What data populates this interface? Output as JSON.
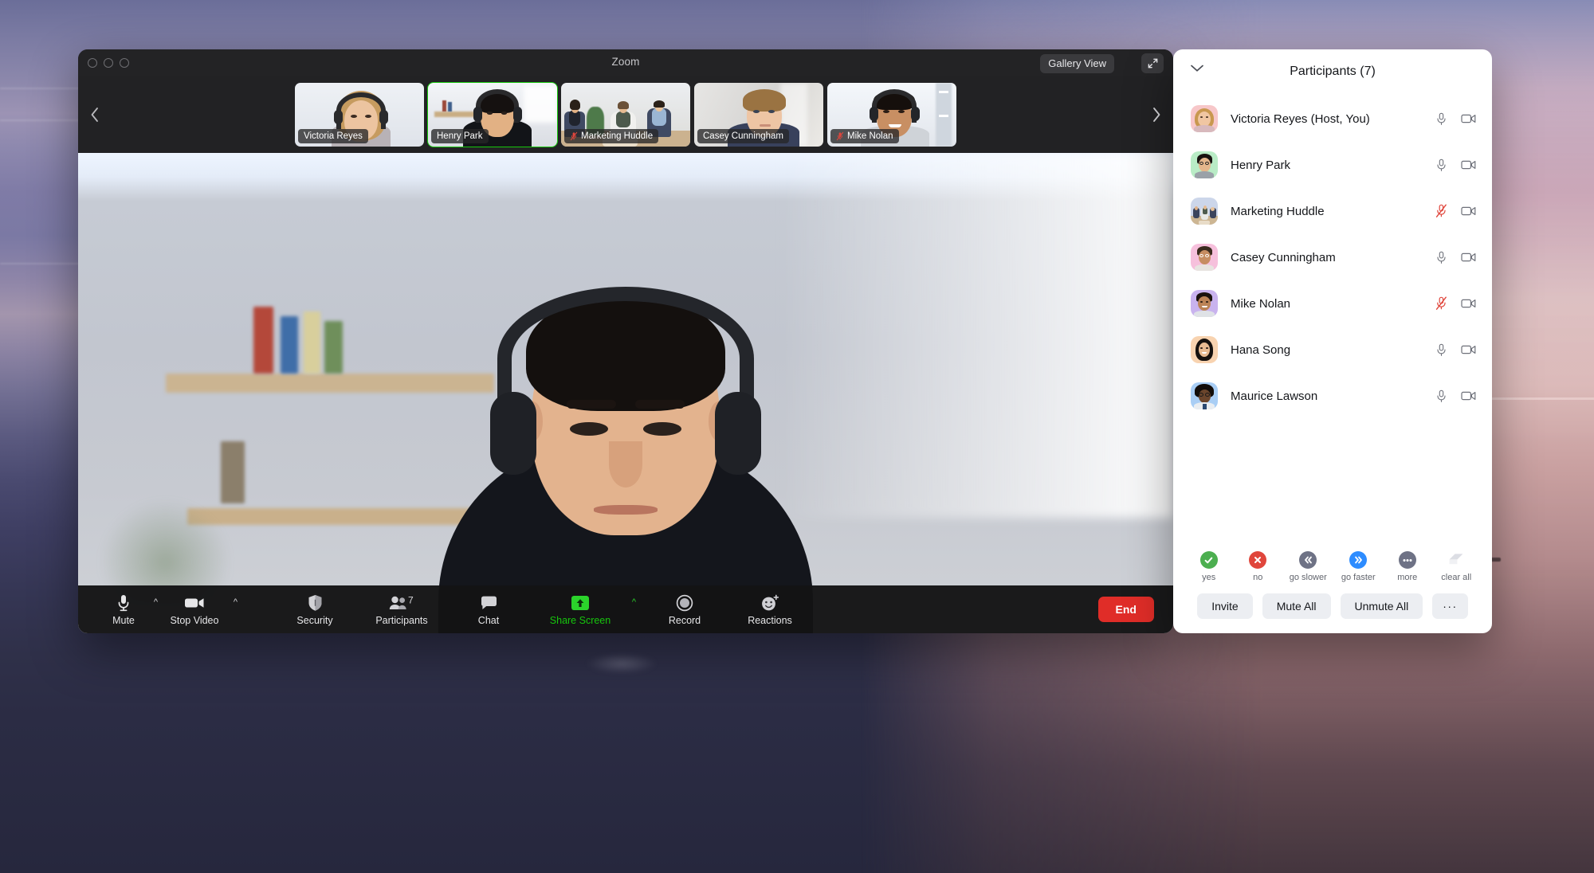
{
  "window": {
    "title": "Zoom",
    "gallery_view_label": "Gallery View",
    "expand_icon": "expand-arrows-icon",
    "traffic_lights": [
      "close",
      "minimize",
      "maximize"
    ]
  },
  "filmstrip": {
    "prev_arrow": "chevron-left-icon",
    "next_arrow": "chevron-right-icon",
    "thumbnails": [
      {
        "name": "Victoria Reyes",
        "muted": false,
        "active": false
      },
      {
        "name": "Henry Park",
        "muted": false,
        "active": true
      },
      {
        "name": "Marketing Huddle",
        "muted": true,
        "active": false
      },
      {
        "name": "Casey Cunningham",
        "muted": false,
        "active": false
      },
      {
        "name": "Mike Nolan",
        "muted": true,
        "active": false
      }
    ]
  },
  "toolbar": {
    "mute_label": "Mute",
    "stop_video_label": "Stop Video",
    "security_label": "Security",
    "participants_label": "Participants",
    "participants_count": "7",
    "chat_label": "Chat",
    "share_screen_label": "Share Screen",
    "record_label": "Record",
    "reactions_label": "Reactions",
    "end_label": "End",
    "share_accent_color": "#16c60c",
    "end_color": "#e02d28"
  },
  "participants_panel": {
    "title": "Participants (7)",
    "collapse_icon": "chevron-down-icon",
    "rows": [
      {
        "name": "Victoria Reyes (Host, You)",
        "muted": false,
        "video": true,
        "avatar_bg": "#f7c7c9"
      },
      {
        "name": "Henry Park",
        "muted": false,
        "video": true,
        "avatar_bg": "#b9ecc6"
      },
      {
        "name": "Marketing Huddle",
        "muted": true,
        "video": true,
        "avatar_bg": "#ccd6ea"
      },
      {
        "name": "Casey Cunningham",
        "muted": false,
        "video": true,
        "avatar_bg": "#f6c0dc"
      },
      {
        "name": "Mike Nolan",
        "muted": true,
        "video": true,
        "avatar_bg": "#c9b3ee"
      },
      {
        "name": "Hana Song",
        "muted": false,
        "video": true,
        "avatar_bg": "#f8d3b0"
      },
      {
        "name": "Maurice Lawson",
        "muted": false,
        "video": true,
        "avatar_bg": "#a9cef5"
      }
    ],
    "reactions": [
      {
        "label": "yes",
        "icon": "check-circle-icon",
        "color": "#4caf50"
      },
      {
        "label": "no",
        "icon": "x-circle-icon",
        "color": "#e0463c"
      },
      {
        "label": "go slower",
        "icon": "double-chevron-left-icon",
        "color": "#6e7285"
      },
      {
        "label": "go faster",
        "icon": "double-chevron-right-icon",
        "color": "#2d8cff"
      },
      {
        "label": "more",
        "icon": "ellipsis-circle-icon",
        "color": "#6e7285"
      },
      {
        "label": "clear all",
        "icon": "eraser-icon",
        "color": "#dcdee4"
      }
    ],
    "actions": {
      "invite": "Invite",
      "mute_all": "Mute All",
      "unmute_all": "Unmute All",
      "more": "···"
    }
  }
}
